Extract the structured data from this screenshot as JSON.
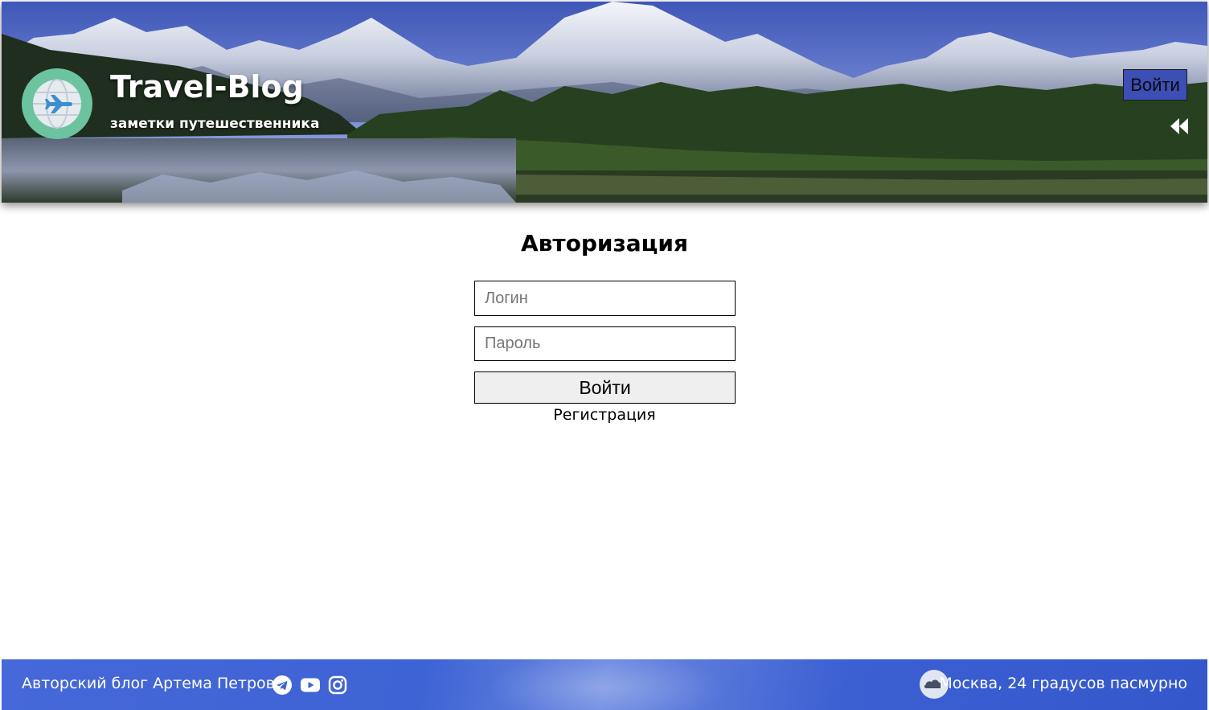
{
  "header": {
    "title": "Travel-Blog",
    "subtitle": "заметки путешественника",
    "login_label": "Войти"
  },
  "auth": {
    "title": "Авторизация",
    "login_placeholder": "Логин",
    "password_placeholder": "Пароль",
    "submit_label": "Войти",
    "register_label": "Регистрация"
  },
  "footer": {
    "author": "Авторский блог Артема Петрова",
    "weather": "Москва, 24 градусов пасмурно",
    "icons": [
      "telegram-icon",
      "youtube-icon",
      "instagram-icon",
      "cloud-weather-icon"
    ]
  },
  "colors": {
    "accent": "#3c4fb4",
    "footer": "#3e63d4",
    "logo_ring": "#6cc3a0"
  }
}
